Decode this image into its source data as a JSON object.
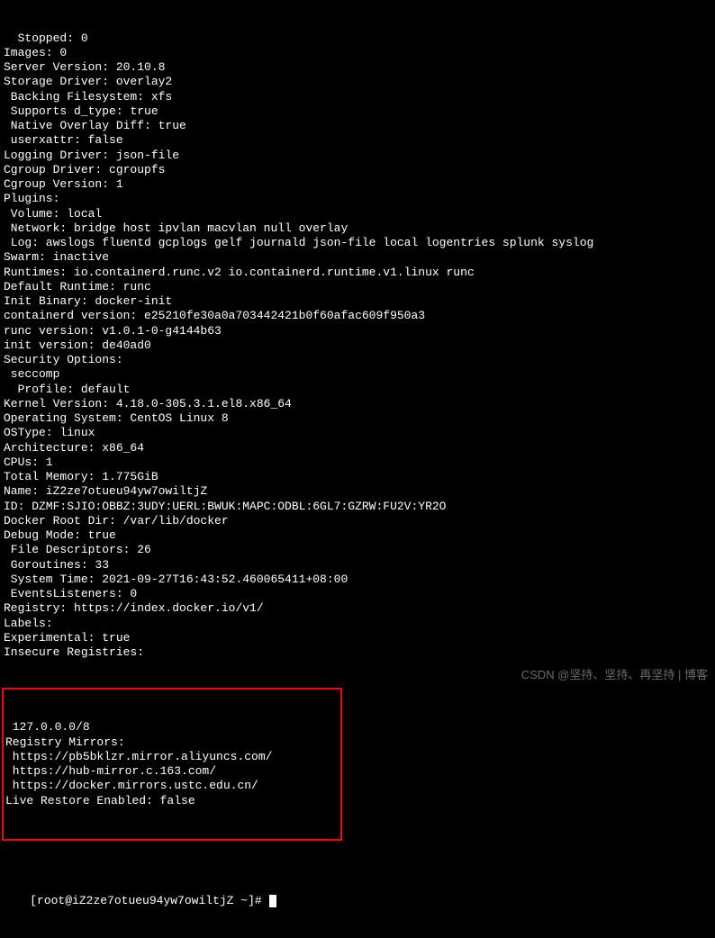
{
  "terminal": {
    "lines": [
      {
        "text": "  Stopped: 0",
        "cls": "line"
      },
      {
        "text": "Images: 0",
        "cls": "line"
      },
      {
        "text": "Server Version: 20.10.8",
        "cls": "line"
      },
      {
        "text": "Storage Driver: overlay2",
        "cls": "line"
      },
      {
        "text": " Backing Filesystem: xfs",
        "cls": "line"
      },
      {
        "text": " Supports d_type: true",
        "cls": "line"
      },
      {
        "text": " Native Overlay Diff: true",
        "cls": "line"
      },
      {
        "text": " userxattr: false",
        "cls": "line"
      },
      {
        "text": "Logging Driver: json-file",
        "cls": "line"
      },
      {
        "text": "Cgroup Driver: cgroupfs",
        "cls": "line"
      },
      {
        "text": "Cgroup Version: 1",
        "cls": "line"
      },
      {
        "text": "Plugins:",
        "cls": "line"
      },
      {
        "text": " Volume: local",
        "cls": "line"
      },
      {
        "text": " Network: bridge host ipvlan macvlan null overlay",
        "cls": "line"
      },
      {
        "text": " Log: awslogs fluentd gcplogs gelf journald json-file local logentries splunk syslog",
        "cls": "line"
      },
      {
        "text": "Swarm: inactive",
        "cls": "line"
      },
      {
        "text": "Runtimes: io.containerd.runc.v2 io.containerd.runtime.v1.linux runc",
        "cls": "line"
      },
      {
        "text": "Default Runtime: runc",
        "cls": "line"
      },
      {
        "text": "Init Binary: docker-init",
        "cls": "line"
      },
      {
        "text": "containerd version: e25210fe30a0a703442421b0f60afac609f950a3",
        "cls": "line"
      },
      {
        "text": "runc version: v1.0.1-0-g4144b63",
        "cls": "line"
      },
      {
        "text": "init version: de40ad0",
        "cls": "line"
      },
      {
        "text": "Security Options:",
        "cls": "line"
      },
      {
        "text": " seccomp",
        "cls": "line"
      },
      {
        "text": "  Profile: default",
        "cls": "line"
      },
      {
        "text": "Kernel Version: 4.18.0-305.3.1.el8.x86_64",
        "cls": "line"
      },
      {
        "text": "Operating System: CentOS Linux 8",
        "cls": "line"
      },
      {
        "text": "OSType: linux",
        "cls": "line"
      },
      {
        "text": "Architecture: x86_64",
        "cls": "line"
      },
      {
        "text": "CPUs: 1",
        "cls": "line"
      },
      {
        "text": "Total Memory: 1.775GiB",
        "cls": "line"
      },
      {
        "text": "Name: iZ2ze7otueu94yw7owiltjZ",
        "cls": "line"
      },
      {
        "text": "ID: DZMF:SJIO:OBBZ:3UDY:UERL:BWUK:MAPC:ODBL:6GL7:GZRW:FU2V:YR2O",
        "cls": "line"
      },
      {
        "text": "Docker Root Dir: /var/lib/docker",
        "cls": "line"
      },
      {
        "text": "Debug Mode: true",
        "cls": "line"
      },
      {
        "text": " File Descriptors: 26",
        "cls": "line"
      },
      {
        "text": " Goroutines: 33",
        "cls": "line"
      },
      {
        "text": " System Time: 2021-09-27T16:43:52.460065411+08:00",
        "cls": "line"
      },
      {
        "text": " EventsListeners: 0",
        "cls": "line"
      },
      {
        "text": "Registry: https://index.docker.io/v1/",
        "cls": "line"
      },
      {
        "text": "Labels:",
        "cls": "line"
      },
      {
        "text": "Experimental: true",
        "cls": "line"
      },
      {
        "text": "Insecure Registries:",
        "cls": "line"
      }
    ],
    "highlighted": [
      {
        "text": " 127.0.0.0/8",
        "cls": "line"
      },
      {
        "text": "Registry Mirrors:",
        "cls": "line"
      },
      {
        "text": " https://pb5bklzr.mirror.aliyuncs.com/",
        "cls": "line"
      },
      {
        "text": " https://hub-mirror.c.163.com/",
        "cls": "line"
      },
      {
        "text": " https://docker.mirrors.ustc.edu.cn/",
        "cls": "line"
      },
      {
        "text": "Live Restore Enabled: false",
        "cls": "line"
      }
    ],
    "prompt": {
      "user_host": "root@iZ2ze7otueu94yw7owiltjZ",
      "path": "~",
      "symbol": "#"
    }
  },
  "watermark": "CSDN @坚持、坚持、再坚持 | 博客"
}
